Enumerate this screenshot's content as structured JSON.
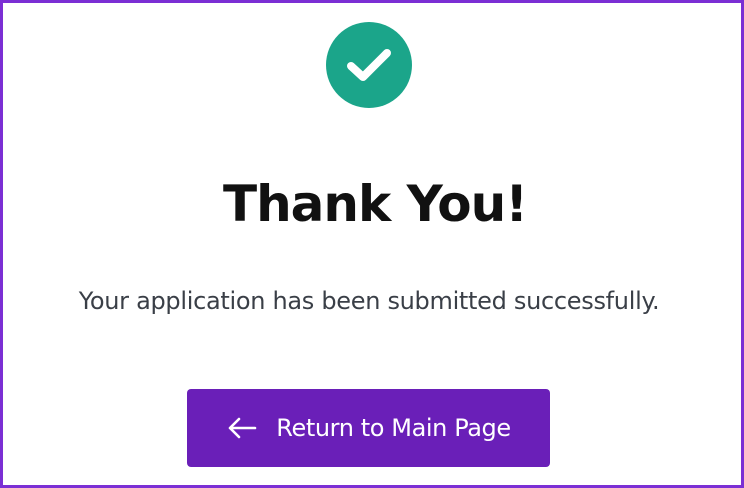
{
  "confirmation": {
    "icon": "check-circle-icon",
    "title": "Thank You!",
    "message": "Your application has been submitted successfully.",
    "return_button": {
      "label": "Return to Main Page",
      "icon": "arrow-left-icon"
    }
  },
  "colors": {
    "frame_border": "#7b2fd4",
    "success_green": "#1ba58a",
    "button_bg": "#6a1fb8",
    "title_text": "#111111",
    "body_text": "#3a3f47"
  }
}
